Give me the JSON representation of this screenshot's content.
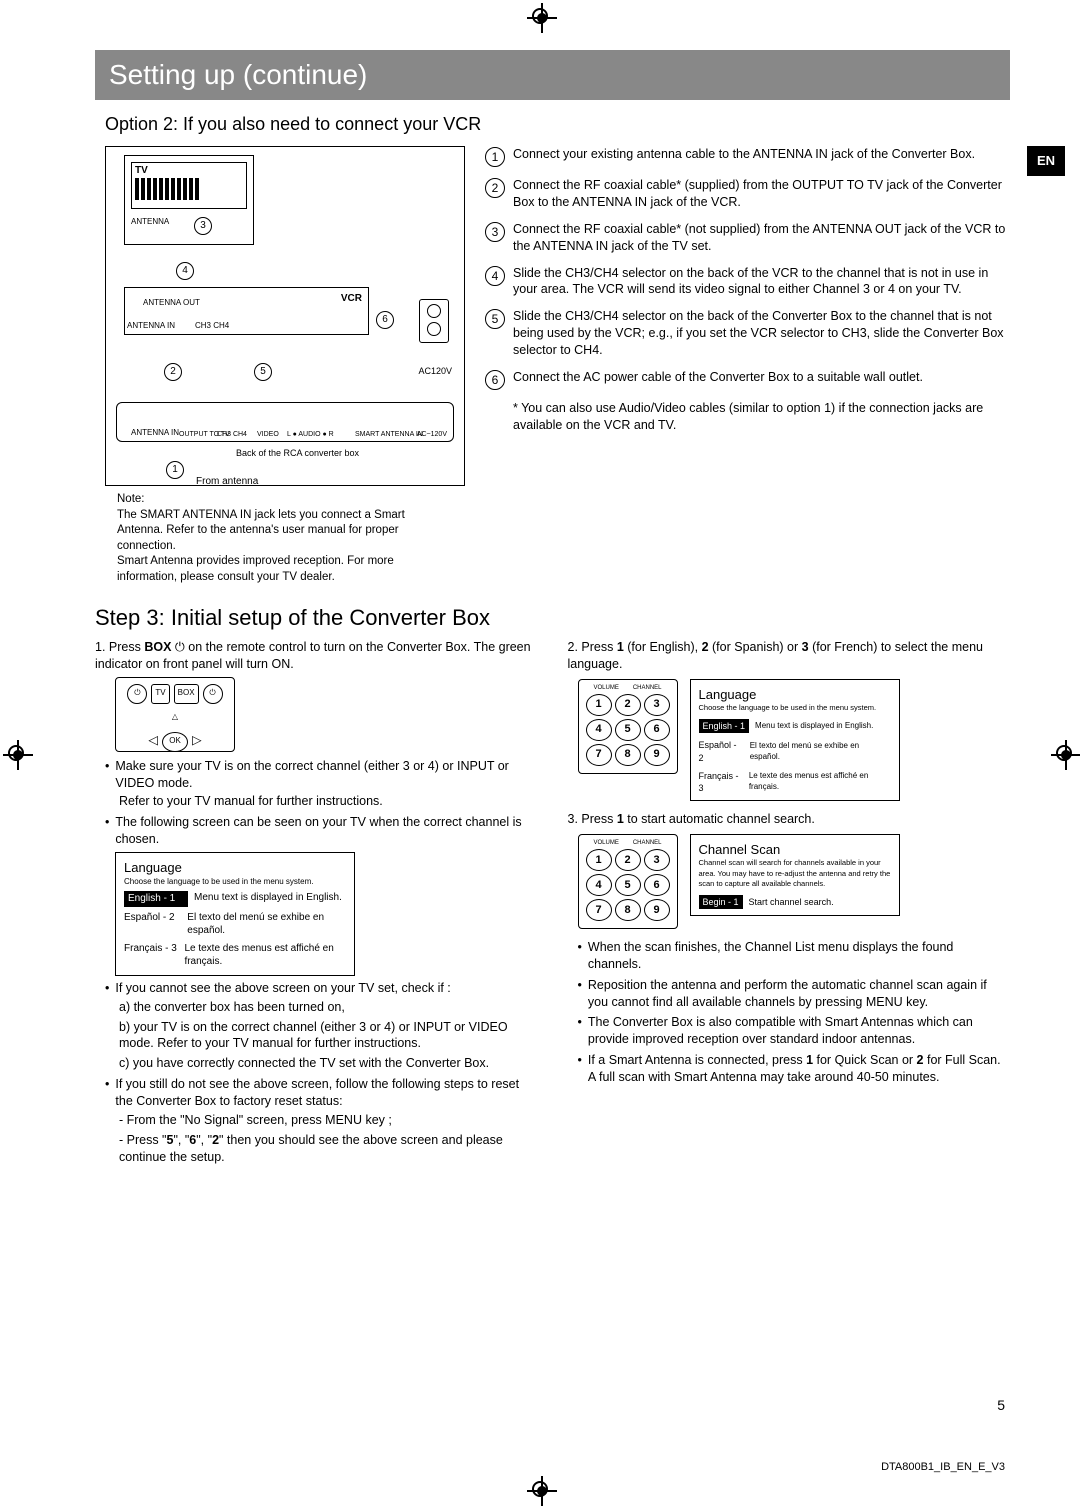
{
  "title": "Setting up (continue)",
  "option2_title": "Option 2: If you also need to connect your VCR",
  "lang_badge": "EN",
  "diagram": {
    "tv_label": "TV",
    "vcr_label": "VCR",
    "ac_label": "AC120V",
    "back_caption": "Back of the RCA converter box",
    "from_antenna": "From antenna",
    "antenna_in": "ANTENNA IN",
    "antenna_out": "ANTENNA OUT",
    "ch3ch4": "CH3  CH4",
    "antenna_tiny": "ANTENNA",
    "output_to_tv": "OUTPUT TO TV",
    "video": "VIDEO",
    "audio": "L ● AUDIO ● R",
    "smart_in": "SMART ANTENNA IN",
    "ac120": "AC~120V"
  },
  "steps": [
    "Connect your existing antenna cable to the ANTENNA IN jack of the Converter Box.",
    "Connect the RF coaxial cable* (supplied) from the OUTPUT TO TV jack of the Converter Box to the ANTENNA IN jack of the VCR.",
    "Connect the RF coaxial cable* (not supplied) from the ANTENNA OUT jack of the VCR to the ANTENNA IN jack of the TV set.",
    "Slide the CH3/CH4 selector on the back of the VCR to the channel that is not in use in your area. The VCR will send its video signal to either Channel 3 or 4 on your TV.",
    "Slide the CH3/CH4 selector on the back of the Converter Box to the channel that is not being used by the VCR; e.g., if you set the VCR selector to CH3, slide the Converter Box selector to CH4.",
    "Connect the AC power cable of the Converter Box to a suitable wall outlet."
  ],
  "steps_footnote": "* You can also use Audio/Video cables (similar to option 1) if the connection jacks are available on the VCR and TV.",
  "note_label": "Note:",
  "note_text": "The SMART ANTENNA IN jack lets you connect a Smart Antenna.  Refer to the antenna's user manual for proper connection.\nSmart Antenna provides improved reception. For more information, please consult your TV dealer.",
  "step3_title": "Step 3: Initial setup of the Converter Box",
  "colA": {
    "line1_a": "1.   Press  ",
    "line1_b": "BOX",
    "line1_c": "  ⏻ on the remote control to turn on the Converter Box.  The green indicator on front panel will turn ON.",
    "remote_tv": "TV",
    "remote_box": "BOX",
    "remote_ok": "OK",
    "bul1": "Make sure your TV is on the correct channel (either 3 or 4) or INPUT or VIDEO mode.",
    "bul1b": "Refer to your TV manual for further instructions.",
    "bul2": "The following screen can be seen on your TV when the correct channel is chosen.",
    "bul3": "If you cannot see the above screen on your TV set, check if :",
    "a": "a) the converter box has been turned on,",
    "b": "b) your TV is on the correct channel (either 3 or 4) or INPUT or VIDEO mode. Refer to your TV manual for further instructions.",
    "c": "c) you have correctly connected the TV set with the Converter Box.",
    "bul4": "If you still do not see the above screen, follow the following steps to reset the Converter Box to factory reset status:",
    "d1": "- From the \"No Signal\" screen, press MENU key ;",
    "d2_a": "- Press \"",
    "d2_b": "5",
    "d2_c": "\", \"",
    "d2_d": "6",
    "d2_e": "\", \"",
    "d2_f": "2",
    "d2_g": "\" then you should see the above screen and please continue the setup."
  },
  "lang_screen": {
    "title": "Language",
    "sub": "Choose the language to be used in the menu system.",
    "r1_lbl": "English - 1",
    "r1_txt": "Menu text is displayed in English.",
    "r2_lbl": "Español - 2",
    "r2_txt": "El texto del menú se exhibe en español.",
    "r3_lbl": "Français - 3",
    "r3_txt": "Le texte des menus est affiché en français."
  },
  "colB": {
    "line2_a": "2.   Press  ",
    "line2_b": "1",
    "line2_c": "  (for English),  ",
    "line2_d": "2",
    "line2_e": "  (for Spanish) or ",
    "line2_f": "3",
    "line2_g": "  (for French) to select the menu language.",
    "line3_a": "3.   Press  ",
    "line3_b": "1",
    "line3_c": "  to start automatic channel search.",
    "kp_vol": "VOLUME",
    "kp_ch": "CHANNEL",
    "scan_title": "Channel Scan",
    "scan_sub": "Channel scan will search for channels available in your area. You may have to re-adjust the antenna and retry the scan to capture all available channels.",
    "scan_begin": "Begin - 1",
    "scan_begin_txt": "Start channel search.",
    "bulB1": "When the scan finishes, the Channel List menu displays the found channels.",
    "bulB2": "Reposition the antenna and perform the automatic channel scan again if you cannot find all available channels by pressing MENU key.",
    "bulB3": "The Converter Box is also compatible with Smart Antennas which can provide improved reception over standard indoor antennas.",
    "bulB4_a": "If a Smart Antenna is connected, press ",
    "bulB4_b": "1",
    "bulB4_c": " for Quick Scan or ",
    "bulB4_d": "2",
    "bulB4_e": " for Full Scan. A full scan with Smart Antenna may take around 40-50 minutes."
  },
  "page_num": "5",
  "footer": "DTA800B1_IB_EN_E_V3"
}
